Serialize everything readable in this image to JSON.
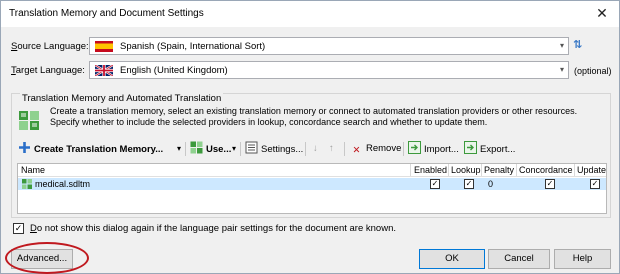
{
  "window": {
    "title": "Translation Memory and Document Settings",
    "close_glyph": "✕"
  },
  "source_language": {
    "label_prefix": "S",
    "label_rest": "ource Language:",
    "value": "Spanish (Spain, International Sort)",
    "arrow": "▾",
    "flag": "spain-flag-icon"
  },
  "swap_glyph": "⇅",
  "target_language": {
    "label_prefix": "T",
    "label_rest": "arget Language:",
    "value": "English (United Kingdom)",
    "arrow": "▾",
    "flag": "uk-flag-icon",
    "optional": "(optional)"
  },
  "group": {
    "title": "Translation Memory and Automated Translation",
    "description_line1": "Create a translation memory, select an existing translation memory or connect to automated translation providers or other resources.",
    "description_line2": "Specify whether to include the selected providers in lookup, concordance search and whether to update them."
  },
  "toolbar": {
    "create": "Create Translation Memory...",
    "use": "Use...",
    "settings": "Settings...",
    "remove": "Remove",
    "import": "Import...",
    "export": "Export...",
    "dropdown_glyph": "▾",
    "down_glyph": "↓",
    "up_glyph": "↑",
    "remove_glyph": "✕"
  },
  "grid": {
    "columns": [
      "Name",
      "Enabled",
      "Lookup",
      "Penalty",
      "Concordance",
      "Update"
    ],
    "rows": [
      {
        "name": "medical.sdltm",
        "enabled": "✓",
        "lookup": "✓",
        "penalty": "0",
        "concordance": "✓",
        "update": "✓"
      }
    ]
  },
  "dont_show": {
    "checked_glyph": "✓",
    "prefix": "D",
    "label": "o not show this dialog again if the language pair settings for the document are known."
  },
  "buttons": {
    "advanced": "Advanced...",
    "ok": "OK",
    "cancel": "Cancel",
    "help": "Help"
  },
  "colors": {
    "highlight_circle": "#c0191f",
    "selected_row": "#cde8ff",
    "accent": "#0078d7"
  }
}
